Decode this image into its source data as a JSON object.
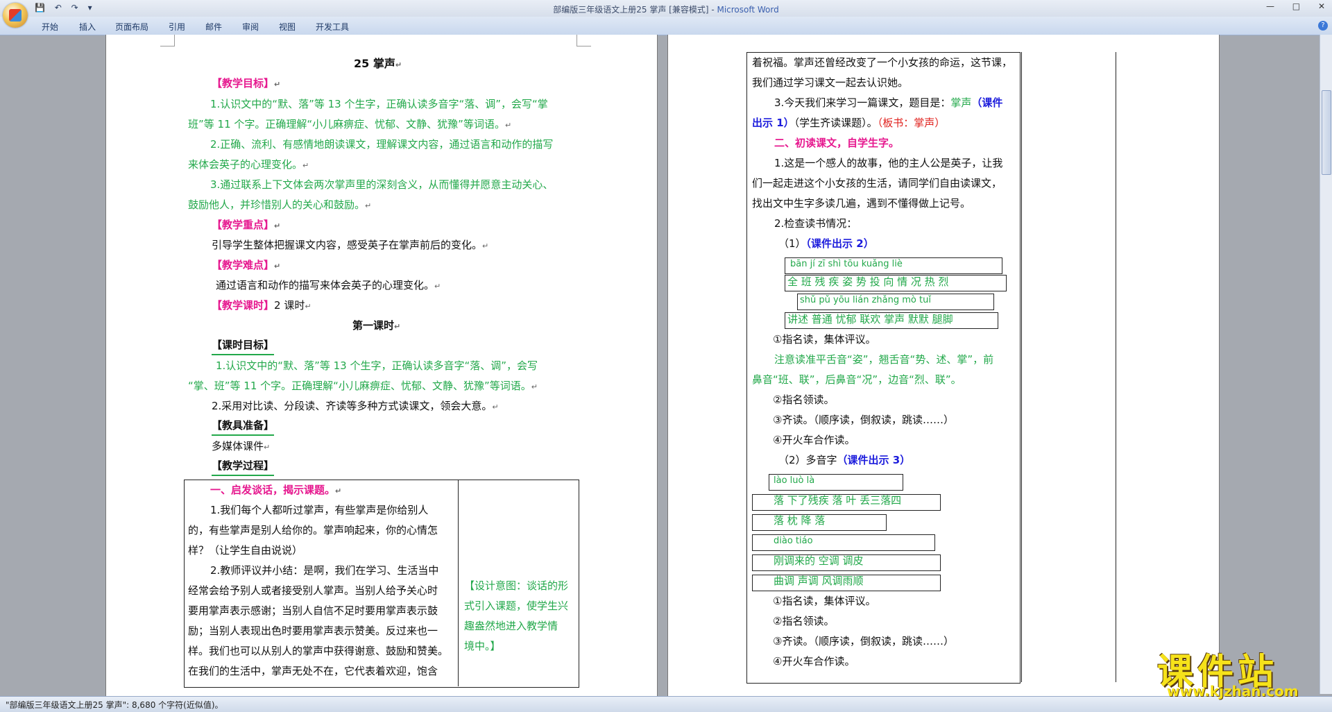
{
  "window": {
    "title": "部编版三年级语文上册25 掌声 [兼容模式]",
    "app_name": "Microsoft Word",
    "title_sep": " - ",
    "controls": [
      "—",
      "□",
      "✕"
    ]
  },
  "ribbon": {
    "tabs": [
      "开始",
      "插入",
      "页面布局",
      "引用",
      "邮件",
      "审阅",
      "视图",
      "开发工具"
    ]
  },
  "qat": {
    "save": "💾",
    "undo": "↶",
    "redo": "↷",
    "more": "▾"
  },
  "para_mark": "↵",
  "page1": {
    "title": "25  掌声",
    "goal_head": "【教学目标】",
    "goal1a": "1.认识文中的“默、落”等 13 个生字，正确认读多音字“落、调”，会写“掌",
    "goal1b": "班”等 11 个字。正确理解“小儿麻痹症、忧郁、文静、犹豫”等词语。",
    "goal2a": "2.正确、流利、有感情地朗读课文，理解课文内容，通过语言和动作的描写",
    "goal2b": "来体会英子的心理变化。",
    "goal3a": "3.通过联系上下文体会两次掌声里的深刻含义，从而懂得并愿意主动关心、",
    "goal3b": "鼓励他人，并珍惜别人的关心和鼓励。",
    "key_head": "【教学重点】",
    "key_text": "引导学生整体把握课文内容，感受英子在掌声前后的变化。",
    "diff_head": "【教学难点】",
    "diff_text": "通过语言和动作的描写来体会英子的心理变化。",
    "hours_head": "【教学课时】",
    "hours_text": "2 课时",
    "lesson_title": "第一课时",
    "obj_head": "【课时目标】",
    "obj1a": "1.认识文中的“默、落”等 13 个生字，正确认读多音字“落、调”，会写",
    "obj1b": "“掌、班”等 11 个字。正确理解“小儿麻痹症、忧郁、文静、犹豫”等词语。",
    "obj2": "2.采用对比读、分段读、齐读等多种方式读课文，领会大意。",
    "tools_head": "【教具准备】",
    "tools_text": "多媒体课件",
    "process_head": "【教学过程】",
    "sec1": "一、启发谈话，揭示课题。",
    "t1a": "1.我们每个人都听过掌声，有些掌声是你给别人",
    "t1b": "的，有些掌声是别人给你的。掌声响起来，你的心情怎",
    "t1c": "样？（让学生自由说说）",
    "t2a": "2.教师评议并小结：是啊，我们在学习、生活当中",
    "t2b": "经常会给予别人或者接受别人掌声。当别人给予关心时",
    "t2c": "要用掌声表示感谢；当别人自信不足时要用掌声表示鼓",
    "t2d": "励；当别人表现出色时要用掌声表示赞美。反过来也一",
    "t2e": "样。我们也可以从别人的掌声中获得谢意、鼓励和赞美。",
    "t2f": "在我们的生活中，掌声无处不在，它代表着欢迎，饱含",
    "design1": "【设计意图：谈话的形",
    "design2": "式引入课题，使学生兴",
    "design3": "趣盎然地进入教学情",
    "design4": "境中。】"
  },
  "page2": {
    "c1": "着祝福。掌声还曾经改变了一个小女孩的命运，这节课，",
    "c2": "我们通过学习课文一起去认识她。",
    "c3a": "3.今天我们来学习一篇课文，题目是：",
    "c3b": "掌声",
    "c3c": "（课件",
    "c4a": "出示 1）",
    "c4b": "（学生齐读课题）。",
    "c4c": "（板书：掌声）",
    "sec2": "二、初读课文，自学生字。",
    "s1a": "1.这是一个感人的故事，他的主人公是英子，让我",
    "s1b": "们一起走进这个小女孩的生活，请同学们自由读课文，",
    "s1c": "找出文中生字多读几遍，遇到不懂得做上记号。",
    "s2": "2.检查读书情况：",
    "s3a": "（1）",
    "s3b": "（课件出示 2）",
    "py1": "bān     jí  zī shì  tōu   kuǎng  liè",
    "wd1": "全 班  残 疾  姿 势 投 向  情 况 热 烈",
    "py2": "shǔ pǔ  yōu  lián  zhǎng  mò   tuǐ",
    "wd2": "讲述 普通 忧郁 联欢  掌声  默默 腿脚",
    "r1": "①指名读，集体评议。",
    "n1": "注意读准平舌音“姿”，翘舌音“势、述、掌”，前",
    "n2": "鼻音“班、联”，后鼻音“况”，边音“烈、联”。",
    "r2": "②指名领读。",
    "r3": "③齐读。（顺序读，倒叙读，跳读……）",
    "r4": "④开火车合作读。",
    "p2a": "（2）多音字",
    "p2b": "（课件出示 3）",
    "pyl": "lào           luò        là",
    "wl1": "落  下了残疾   落 叶  丢三落四",
    "wl2": "落 枕      降 落",
    "pyd": "diào                        tiáo",
    "wd3": "刚调来的           空调  调皮",
    "wd4": "曲调  声调           风调雨顺",
    "q1": "①指名读，集体评议。",
    "q2": "②指名领读。",
    "q3": "③齐读。（顺序读，倒叙读，跳读……）",
    "q4": "④开火车合作读。"
  },
  "status": {
    "text": "\"部编版三年级语文上册25 掌声\": 8,680 个字符(近似值)。"
  },
  "watermark": {
    "main": "课件站",
    "url": "www.kjzhan.com"
  }
}
